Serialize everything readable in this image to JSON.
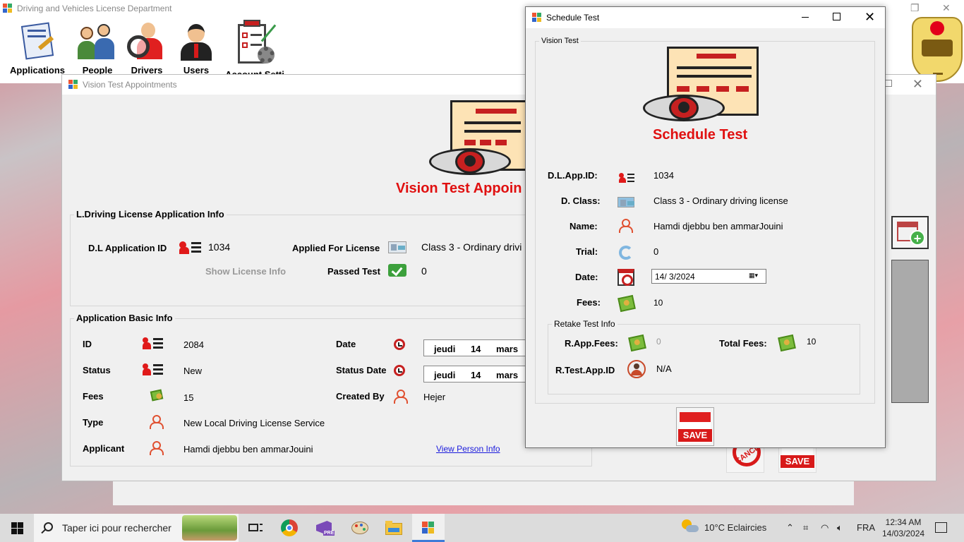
{
  "main_window": {
    "title": "Driving and Vehicles License Department",
    "toolbar": [
      {
        "label": "Applications",
        "icon": "applications-icon"
      },
      {
        "label": "People",
        "icon": "people-icon"
      },
      {
        "label": "Drivers",
        "icon": "drivers-icon"
      },
      {
        "label": "Users",
        "icon": "users-icon"
      },
      {
        "label": "Account Setti",
        "icon": "account-settings-icon"
      }
    ]
  },
  "appointments_window": {
    "title": "Vision Test Appointments",
    "heading": "Vision Test Appoin",
    "license_group": {
      "title": "L.Driving License Application Info",
      "app_id_label": "D.L Application ID",
      "app_id_value": "1034",
      "applied_for_label": "Applied For License",
      "applied_for_value": "Class 3 - Ordinary drivi",
      "show_license_info": "Show License Info",
      "passed_test_label": "Passed Test",
      "passed_test_value": "0"
    },
    "basic_group": {
      "title": "Application Basic Info",
      "id_label": "ID",
      "id_value": "2084",
      "status_label": "Status",
      "status_value": "New",
      "fees_label": "Fees",
      "fees_value": "15",
      "type_label": "Type",
      "type_value": "New Local Driving License Service",
      "applicant_label": "Applicant",
      "applicant_value": "Hamdi djebbu ben ammarJouini",
      "date_label": "Date",
      "date_value": "jeudi 14 mars",
      "status_date_label": "Status Date",
      "status_date_value": "jeudi 14 mars",
      "created_by_label": "Created By",
      "created_by_value": "Hejer",
      "view_person_info": "View Person Info"
    },
    "save_label": "SAVE",
    "cancel_label": "CANCEL"
  },
  "schedule_dialog": {
    "title": "Schedule Test",
    "group_title": "Vision Test",
    "heading": "Schedule Test",
    "app_id_label": "D.L.App.ID:",
    "app_id_value": "1034",
    "class_label": "D. Class:",
    "class_value": "Class 3 - Ordinary driving license",
    "name_label": "Name:",
    "name_value": "Hamdi djebbu ben ammarJouini",
    "trial_label": "Trial:",
    "trial_value": "0",
    "date_label": "Date:",
    "date_value": "14/  3/2024",
    "fees_label": "Fees:",
    "fees_value": "10",
    "retake_group_title": "Retake Test Info",
    "r_app_fees_label": "R.App.Fees:",
    "r_app_fees_value": "0",
    "total_fees_label": "Total Fees:",
    "total_fees_value": "10",
    "r_test_app_id_label": "R.Test.App.ID",
    "r_test_app_id_value": "N/A",
    "save_label": "SAVE"
  },
  "taskbar": {
    "search_placeholder": "Taper ici pour rechercher",
    "weather": "10°C  Eclaircies",
    "language": "FRA",
    "time": "12:34 AM",
    "date": "14/03/2024"
  },
  "colors": {
    "accent_red": "#e01010",
    "link_blue": "#1a1adc",
    "taskbar_active": "#3d7bd8"
  }
}
